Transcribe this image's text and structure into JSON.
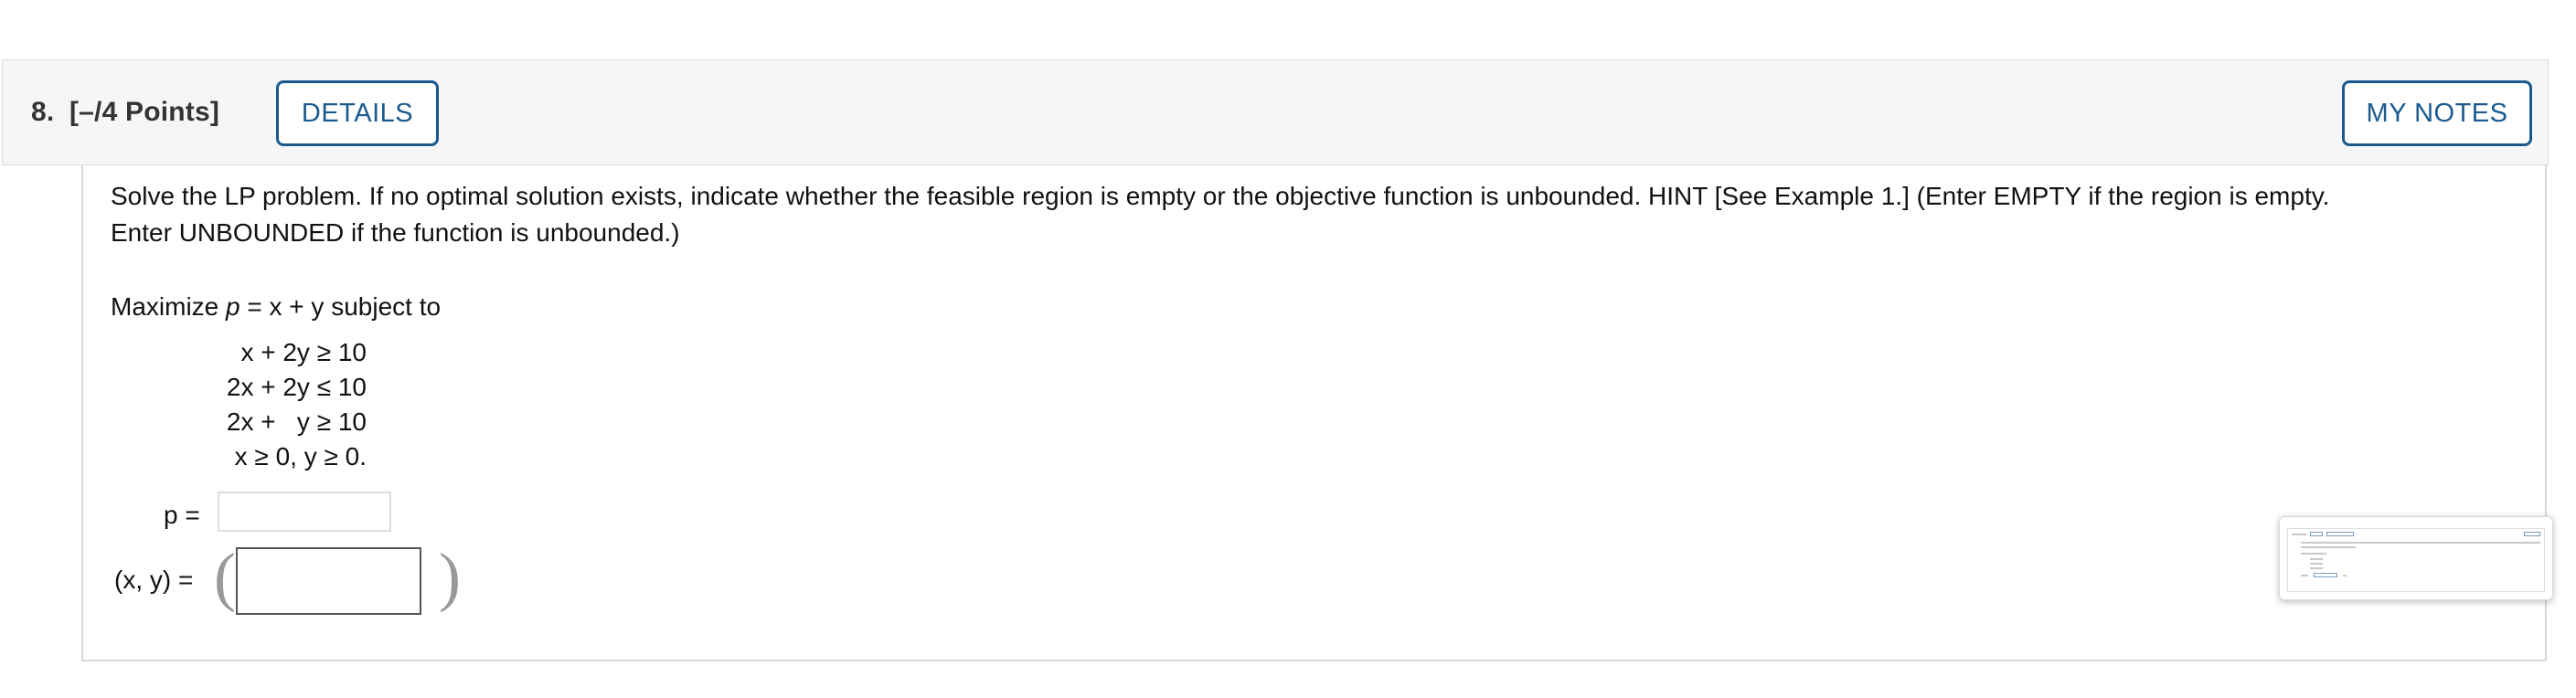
{
  "question": {
    "number": "8.",
    "points": "[–/4 Points]",
    "details_button": "DETAILS",
    "notes_button": "MY NOTES"
  },
  "prompt": {
    "line1": "Solve the LP problem. If no optimal solution exists, indicate whether the feasible region is empty or the objective function is unbounded. HINT [See Example 1.] (Enter EMPTY if the region is empty.",
    "line2": "Enter UNBOUNDED if the function is unbounded.)"
  },
  "objective": {
    "prefix": "Maximize ",
    "var": "p",
    "expr": " = x + y ",
    "suffix": "subject to"
  },
  "constraints": [
    "x + 2y ≥ 10",
    "2x + 2y ≤ 10",
    "2x +   y ≥ 10",
    "x ≥ 0, y ≥ 0."
  ],
  "answers": {
    "p_label": "p =",
    "p_value": "",
    "xy_label": "(x, y) =",
    "xy_value": ""
  },
  "icons": {
    "preview": "page-preview-thumbnail"
  }
}
